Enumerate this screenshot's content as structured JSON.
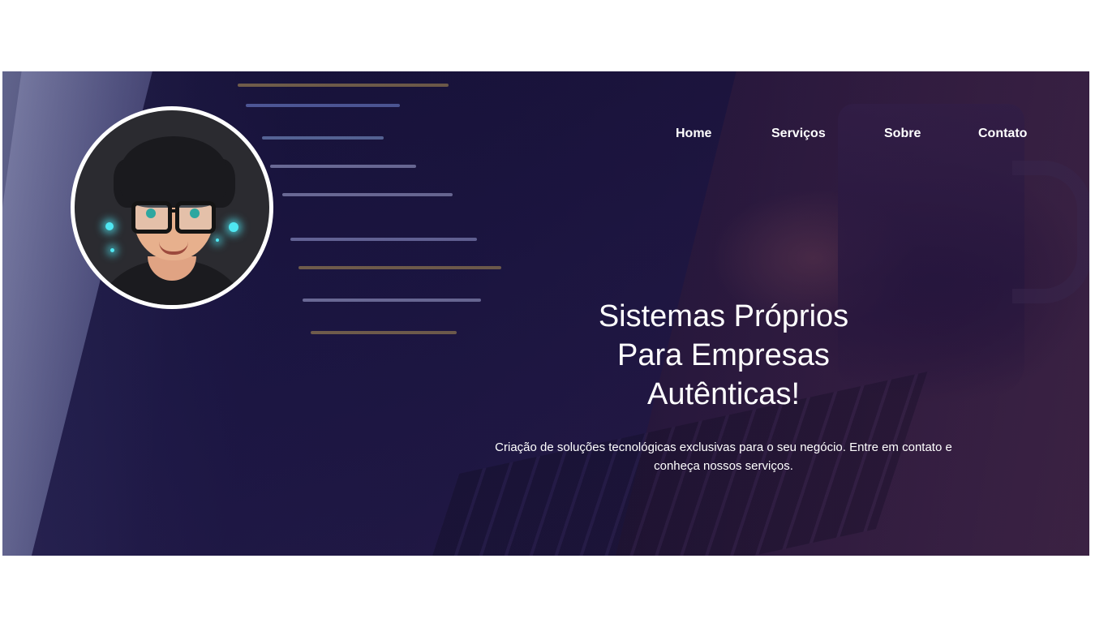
{
  "nav": {
    "items": [
      {
        "label": "Home"
      },
      {
        "label": "Serviços"
      },
      {
        "label": "Sobre"
      },
      {
        "label": "Contato"
      }
    ]
  },
  "hero": {
    "headline": [
      "Sistemas Próprios",
      "Para Empresas",
      "Autênticas!"
    ],
    "subtext": "Criação de soluções tecnológicas exclusivas para o seu negócio. Entre em contato e conheça nossos serviços."
  },
  "colors": {
    "text": "#ffffff",
    "hero_dark": "#1a1539",
    "hero_accent": "#4a2c4c",
    "avatar_border": "#ffffff"
  },
  "icons": {
    "avatar": "cartoon-boy-avatar"
  }
}
